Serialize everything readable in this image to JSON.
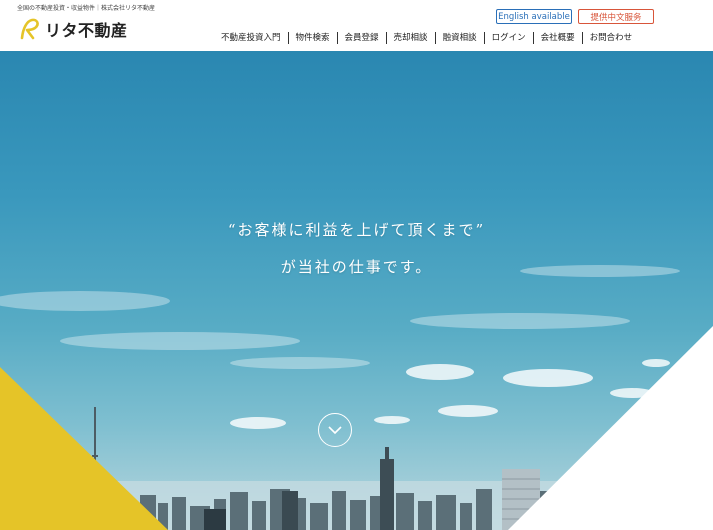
{
  "header": {
    "tagline": "全国の不動産投資・収益物件｜株式会社リタ不動産",
    "logo_text": "リタ不動産",
    "lang_en_label": "English available",
    "lang_zh_label": "提供中文服务"
  },
  "nav": {
    "items": [
      "不動産投資入門",
      "物件検索",
      "会員登録",
      "売却相談",
      "融資相談",
      "ログイン",
      "会社概要",
      "お問合わせ"
    ]
  },
  "hero": {
    "line1": "“お客様に利益を上げて頂くまで”",
    "line2": "が当社の仕事です。"
  },
  "colors": {
    "accent_yellow": "#e5c428",
    "english_blue": "#2a6fb8",
    "chinese_red": "#d8553a",
    "sky": "#2a87b1"
  }
}
